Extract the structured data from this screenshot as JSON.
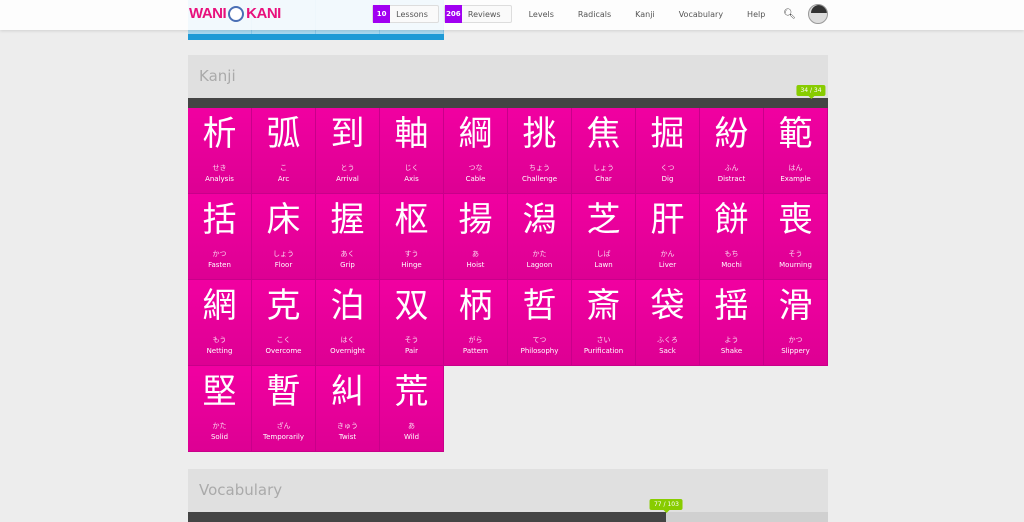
{
  "header": {
    "logo": "WANI KANI",
    "lessons_count": "10",
    "lessons_label": "Lessons",
    "reviews_count": "206",
    "reviews_label": "Reviews",
    "nav": [
      "Levels",
      "Radicals",
      "Kanji",
      "Vocabulary",
      "Help"
    ]
  },
  "kanji": {
    "title": "Kanji",
    "progress_label": "34 / 34",
    "progress": 1.0,
    "items": [
      {
        "c": "析",
        "r": "せき",
        "m": "Analysis"
      },
      {
        "c": "弧",
        "r": "こ",
        "m": "Arc"
      },
      {
        "c": "到",
        "r": "とう",
        "m": "Arrival"
      },
      {
        "c": "軸",
        "r": "じく",
        "m": "Axis"
      },
      {
        "c": "綱",
        "r": "つな",
        "m": "Cable"
      },
      {
        "c": "挑",
        "r": "ちょう",
        "m": "Challenge"
      },
      {
        "c": "焦",
        "r": "しょう",
        "m": "Char"
      },
      {
        "c": "掘",
        "r": "くつ",
        "m": "Dig"
      },
      {
        "c": "紛",
        "r": "ふん",
        "m": "Distract"
      },
      {
        "c": "範",
        "r": "はん",
        "m": "Example"
      },
      {
        "c": "括",
        "r": "かつ",
        "m": "Fasten"
      },
      {
        "c": "床",
        "r": "しょう",
        "m": "Floor"
      },
      {
        "c": "握",
        "r": "あく",
        "m": "Grip"
      },
      {
        "c": "枢",
        "r": "すう",
        "m": "Hinge"
      },
      {
        "c": "揚",
        "r": "あ",
        "m": "Hoist"
      },
      {
        "c": "潟",
        "r": "かた",
        "m": "Lagoon"
      },
      {
        "c": "芝",
        "r": "しば",
        "m": "Lawn"
      },
      {
        "c": "肝",
        "r": "かん",
        "m": "Liver"
      },
      {
        "c": "餅",
        "r": "もち",
        "m": "Mochi"
      },
      {
        "c": "喪",
        "r": "そう",
        "m": "Mourning"
      },
      {
        "c": "網",
        "r": "もう",
        "m": "Netting"
      },
      {
        "c": "克",
        "r": "こく",
        "m": "Overcome"
      },
      {
        "c": "泊",
        "r": "はく",
        "m": "Overnight"
      },
      {
        "c": "双",
        "r": "そう",
        "m": "Pair"
      },
      {
        "c": "柄",
        "r": "がら",
        "m": "Pattern"
      },
      {
        "c": "哲",
        "r": "てつ",
        "m": "Philosophy"
      },
      {
        "c": "斎",
        "r": "さい",
        "m": "Purification"
      },
      {
        "c": "袋",
        "r": "ふくろ",
        "m": "Sack"
      },
      {
        "c": "揺",
        "r": "よう",
        "m": "Shake"
      },
      {
        "c": "滑",
        "r": "かつ",
        "m": "Slippery"
      },
      {
        "c": "堅",
        "r": "かた",
        "m": "Solid"
      },
      {
        "c": "暫",
        "r": "ざん",
        "m": "Temporarily"
      },
      {
        "c": "糾",
        "r": "きゅう",
        "m": "Twist"
      },
      {
        "c": "荒",
        "r": "あ",
        "m": "Wild"
      }
    ]
  },
  "vocabulary": {
    "title": "Vocabulary",
    "progress_label": "77 / 103",
    "progress": 0.7476
  },
  "colors": {
    "kanji": "#f100a1",
    "radical": "#1e9ad6",
    "progress": "#88cc00",
    "count": "#a100f1"
  }
}
